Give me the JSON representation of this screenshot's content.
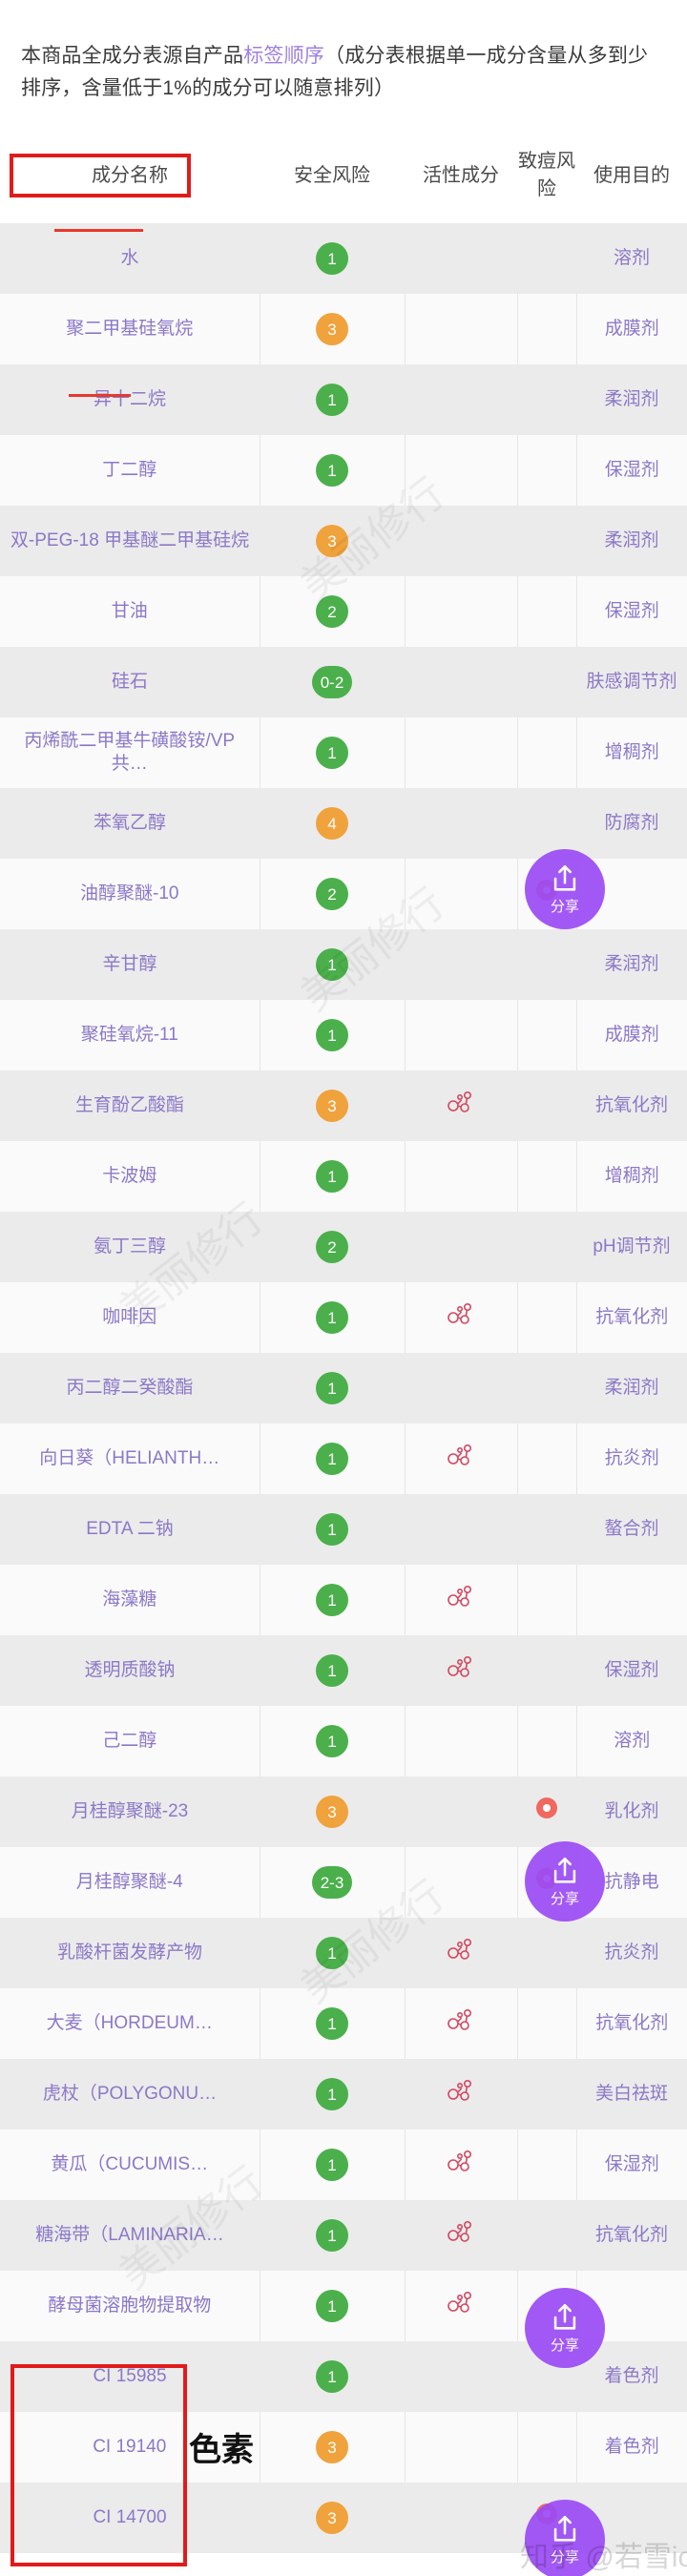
{
  "intro": {
    "text_before": "本商品全成分表源自产品",
    "highlight": "标签顺序",
    "text_after": "（成分表根据单一成分含量从多到少排序，含量低于1%的成分可以随意排列）"
  },
  "table": {
    "headers": {
      "name": "成分名称",
      "safety": "安全风险",
      "active": "活性成分",
      "acne": "致痘风险",
      "use": "使用目的"
    },
    "rows": [
      {
        "name": "水",
        "safety": "1",
        "safety_level": "green",
        "active": false,
        "acne": false,
        "use": "溶剂"
      },
      {
        "name": "聚二甲基硅氧烷",
        "safety": "3",
        "safety_level": "orange",
        "active": false,
        "acne": false,
        "use": "成膜剂"
      },
      {
        "name": "异十二烷",
        "safety": "1",
        "safety_level": "green",
        "active": false,
        "acne": false,
        "use": "柔润剂"
      },
      {
        "name": "丁二醇",
        "safety": "1",
        "safety_level": "green",
        "active": false,
        "acne": false,
        "use": "保湿剂"
      },
      {
        "name": "双-PEG-18 甲基醚二甲基硅烷",
        "safety": "3",
        "safety_level": "orange",
        "active": false,
        "acne": false,
        "use": "柔润剂"
      },
      {
        "name": "甘油",
        "safety": "2",
        "safety_level": "green",
        "active": false,
        "acne": false,
        "use": "保湿剂"
      },
      {
        "name": "硅石",
        "safety": "0-2",
        "safety_level": "green",
        "active": false,
        "acne": false,
        "use": "肤感调节剂"
      },
      {
        "name": "丙烯酰二甲基牛磺酸铵/VP 共…",
        "safety": "1",
        "safety_level": "green",
        "active": false,
        "acne": false,
        "use": "增稠剂"
      },
      {
        "name": "苯氧乙醇",
        "safety": "4",
        "safety_level": "orange",
        "active": false,
        "acne": false,
        "use": "防腐剂"
      },
      {
        "name": "油醇聚醚-10",
        "safety": "2",
        "safety_level": "green",
        "active": false,
        "acne": true,
        "use": ""
      },
      {
        "name": "辛甘醇",
        "safety": "1",
        "safety_level": "green",
        "active": false,
        "acne": false,
        "use": "柔润剂"
      },
      {
        "name": "聚硅氧烷-11",
        "safety": "1",
        "safety_level": "green",
        "active": false,
        "acne": false,
        "use": "成膜剂"
      },
      {
        "name": "生育酚乙酸酯",
        "safety": "3",
        "safety_level": "orange",
        "active": true,
        "acne": false,
        "use": "抗氧化剂"
      },
      {
        "name": "卡波姆",
        "safety": "1",
        "safety_level": "green",
        "active": false,
        "acne": false,
        "use": "增稠剂"
      },
      {
        "name": "氨丁三醇",
        "safety": "2",
        "safety_level": "green",
        "active": false,
        "acne": false,
        "use": "pH调节剂"
      },
      {
        "name": "咖啡因",
        "safety": "1",
        "safety_level": "green",
        "active": true,
        "acne": false,
        "use": "抗氧化剂"
      },
      {
        "name": "丙二醇二癸酸酯",
        "safety": "1",
        "safety_level": "green",
        "active": false,
        "acne": false,
        "use": "柔润剂"
      },
      {
        "name": "向日葵（HELIANTH…",
        "safety": "1",
        "safety_level": "green",
        "active": true,
        "acne": false,
        "use": "抗炎剂"
      },
      {
        "name": "EDTA 二钠",
        "safety": "1",
        "safety_level": "green",
        "active": false,
        "acne": false,
        "use": "螯合剂"
      },
      {
        "name": "海藻糖",
        "safety": "1",
        "safety_level": "green",
        "active": true,
        "acne": false,
        "use": ""
      },
      {
        "name": "透明质酸钠",
        "safety": "1",
        "safety_level": "green",
        "active": true,
        "acne": false,
        "use": "保湿剂"
      },
      {
        "name": "己二醇",
        "safety": "1",
        "safety_level": "green",
        "active": false,
        "acne": false,
        "use": "溶剂"
      },
      {
        "name": "月桂醇聚醚-23",
        "safety": "3",
        "safety_level": "orange",
        "active": false,
        "acne": true,
        "use": "乳化剂"
      },
      {
        "name": "月桂醇聚醚-4",
        "safety": "2-3",
        "safety_level": "green",
        "active": false,
        "acne": true,
        "use": "抗静电"
      },
      {
        "name": "乳酸杆菌发酵产物",
        "safety": "1",
        "safety_level": "green",
        "active": true,
        "acne": false,
        "use": "抗炎剂"
      },
      {
        "name": "大麦（HORDEUM…",
        "safety": "1",
        "safety_level": "green",
        "active": true,
        "acne": false,
        "use": "抗氧化剂"
      },
      {
        "name": "虎杖（POLYGONU…",
        "safety": "1",
        "safety_level": "green",
        "active": true,
        "acne": false,
        "use": "美白祛斑"
      },
      {
        "name": "黄瓜（CUCUMIS…",
        "safety": "1",
        "safety_level": "green",
        "active": true,
        "acne": false,
        "use": "保湿剂"
      },
      {
        "name": "糖海带（LAMINARIA…",
        "safety": "1",
        "safety_level": "green",
        "active": true,
        "acne": false,
        "use": "抗氧化剂"
      },
      {
        "name": "酵母菌溶胞物提取物",
        "safety": "1",
        "safety_level": "green",
        "active": true,
        "acne": false,
        "use": ""
      },
      {
        "name": "CI 15985",
        "safety": "1",
        "safety_level": "green",
        "active": false,
        "acne": false,
        "use": "着色剂"
      },
      {
        "name": "CI 19140",
        "safety": "3",
        "safety_level": "orange",
        "active": false,
        "acne": false,
        "use": "着色剂"
      },
      {
        "name": "CI 14700",
        "safety": "3",
        "safety_level": "orange",
        "active": false,
        "acne": true,
        "use": ""
      }
    ]
  },
  "annotations": {
    "pigment_label": "色素"
  },
  "share": {
    "label": "分享"
  },
  "watermarks": {
    "brand": "美丽修行",
    "zhihu": "知乎 @若雪ious"
  },
  "colors": {
    "accent_purple": "#9b4bf5",
    "name_purple": "#9b86d6",
    "safe_green": "#4bb04b",
    "safe_orange": "#f0a23c",
    "acne_red": "#f0685f",
    "anno_red": "#e01b1b"
  }
}
